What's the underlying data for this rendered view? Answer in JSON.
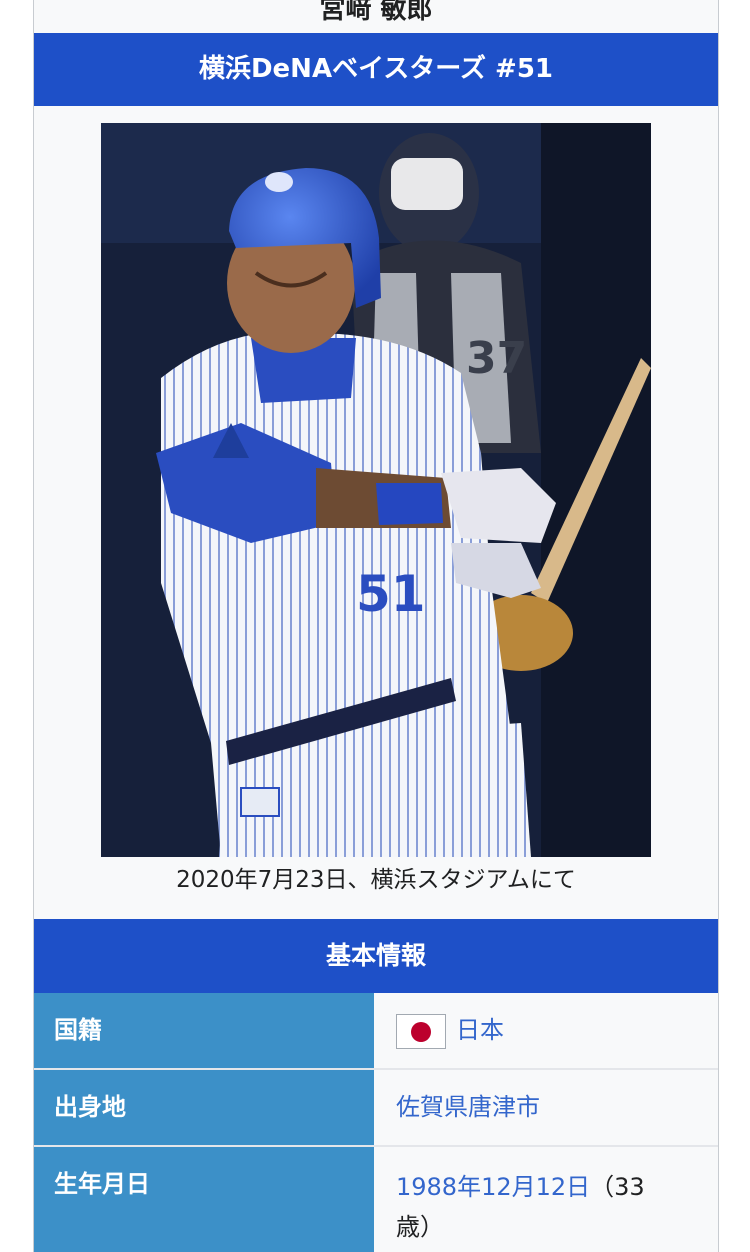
{
  "player": {
    "name": "宮﨑 敏郎",
    "team_number": "横浜DeNAベイスターズ #51",
    "jersey_number": "51",
    "photo_caption": "2020年7月23日、横浜スタジアムにて"
  },
  "basic_info": {
    "section_title": "基本情報",
    "rows": [
      {
        "label": "国籍",
        "value": "日本",
        "icon": "japan-flag-icon"
      },
      {
        "label": "出身地",
        "value": "佐賀県唐津市"
      },
      {
        "label": "生年月日",
        "value_link": "1988年12月12日",
        "value_rest": "（33",
        "value_rest_2": "歳）"
      }
    ]
  },
  "colors": {
    "header_blue": "#1e50c8",
    "label_blue": "#3c90c8",
    "link_blue": "#3366cc"
  }
}
